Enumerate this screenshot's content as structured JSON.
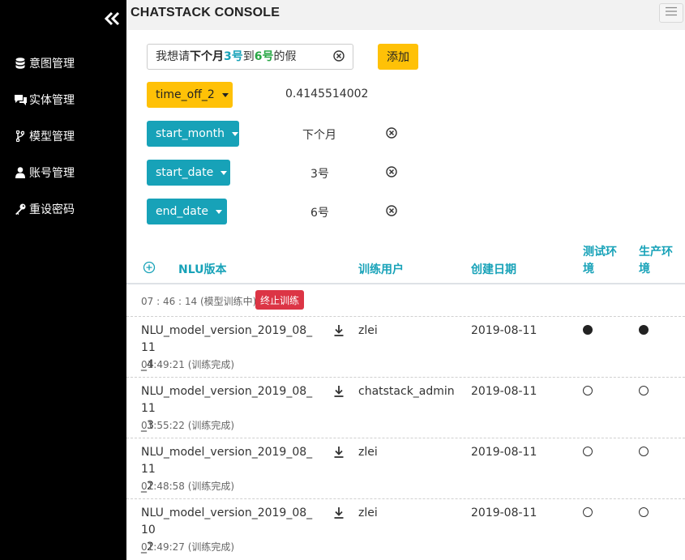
{
  "app": {
    "title": "CHATSTACK CONSOLE"
  },
  "sidebar": {
    "items": [
      {
        "label": "意图管理",
        "icon": "database-icon"
      },
      {
        "label": "实体管理",
        "icon": "comments-icon"
      },
      {
        "label": "模型管理",
        "icon": "code-branch-icon"
      },
      {
        "label": "账号管理",
        "icon": "user-icon"
      },
      {
        "label": "重设密码",
        "icon": "key-icon"
      }
    ]
  },
  "query": {
    "segments": [
      "我想请",
      "下个月",
      "3号",
      "到",
      "6号",
      "的假"
    ],
    "add_label": "添加"
  },
  "slots": [
    {
      "name": "time_off_2",
      "value": "0.4145514002",
      "color": "#ffc107"
    },
    {
      "name": "start_month",
      "value": "下个月",
      "color": "#17a2b8"
    },
    {
      "name": "start_date",
      "value": "3号",
      "color": "#17a2b8"
    },
    {
      "name": "end_date",
      "value": "6号",
      "color": "#17a2b8"
    }
  ],
  "table": {
    "headers": {
      "version": "NLU版本",
      "user": "训练用户",
      "date": "创建日期",
      "test_env": [
        "测试环",
        "境"
      ],
      "prod_env": [
        "生产环",
        "境"
      ]
    },
    "training": {
      "status": "07 : 46 : 14 (模型训练中)",
      "stop_label": "终止训练"
    },
    "rows": [
      {
        "name_line1": "NLU_model_version_2019_08_11",
        "name_line2": "_4",
        "time": "01:49:21 (训练完成)",
        "user": "zlei",
        "date": "2019-08-11",
        "test": true,
        "prod": true
      },
      {
        "name_line1": "NLU_model_version_2019_08_11",
        "name_line2": "_3",
        "time": "01:55:22 (训练完成)",
        "user": "chatstack_admin",
        "date": "2019-08-11",
        "test": false,
        "prod": false
      },
      {
        "name_line1": "NLU_model_version_2019_08_11",
        "name_line2": "_2",
        "time": "01:48:58 (训练完成)",
        "user": "zlei",
        "date": "2019-08-11",
        "test": false,
        "prod": false
      },
      {
        "name_line1": "NLU_model_version_2019_08_10",
        "name_line2": "_2",
        "time": "01:49:27 (训练完成)",
        "user": "zlei",
        "date": "2019-08-11",
        "test": false,
        "prod": false
      }
    ]
  }
}
